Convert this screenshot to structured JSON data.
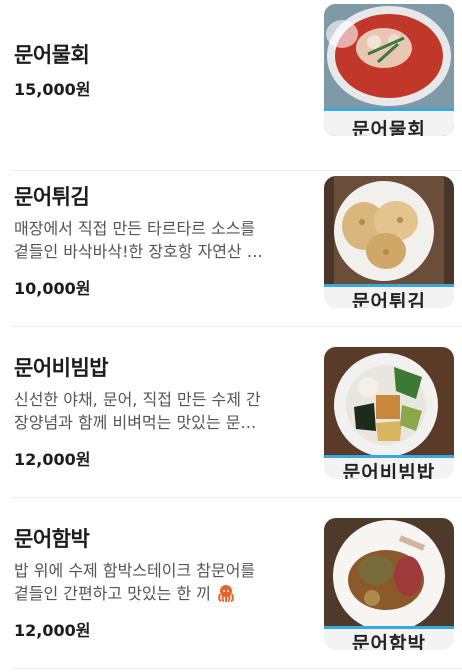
{
  "menu": {
    "currency_suffix": "원",
    "items": [
      {
        "name": "문어물회",
        "desc_lines": [],
        "price": "15,000원",
        "image_caption": "문어물회",
        "image_icon": "mulhoe-photo-icon"
      },
      {
        "name": "문어튀김",
        "desc_lines": [
          "매장에서 직접 만든 타르타르 소스를",
          "곁들인 바삭바삭!한 장호항 자연산 …"
        ],
        "price": "10,000원",
        "image_caption": "문어튀김",
        "image_icon": "fried-octopus-photo-icon"
      },
      {
        "name": "문어비빔밥",
        "desc_lines": [
          "신선한 야채, 문어, 직접 만든 수제 간",
          "장양념과 함께 비벼먹는 맛있는 문…"
        ],
        "price": "12,000원",
        "image_caption": "문어비빔밥",
        "image_icon": "bibimbap-photo-icon"
      },
      {
        "name": "문어함박",
        "desc_lines": [
          "밥 위에 수제 함박스테이크 참문어를",
          "곁들인 간편하고 맛있는 한 끼"
        ],
        "price": "12,000원",
        "image_caption": "문어함박",
        "image_icon": "hambak-photo-icon",
        "desc_emoji": "octopus-icon"
      }
    ]
  },
  "colors": {
    "text": "#1c1c1c",
    "description": "#555555",
    "divider": "#ececec",
    "photo_border": "#3aa8e0"
  }
}
